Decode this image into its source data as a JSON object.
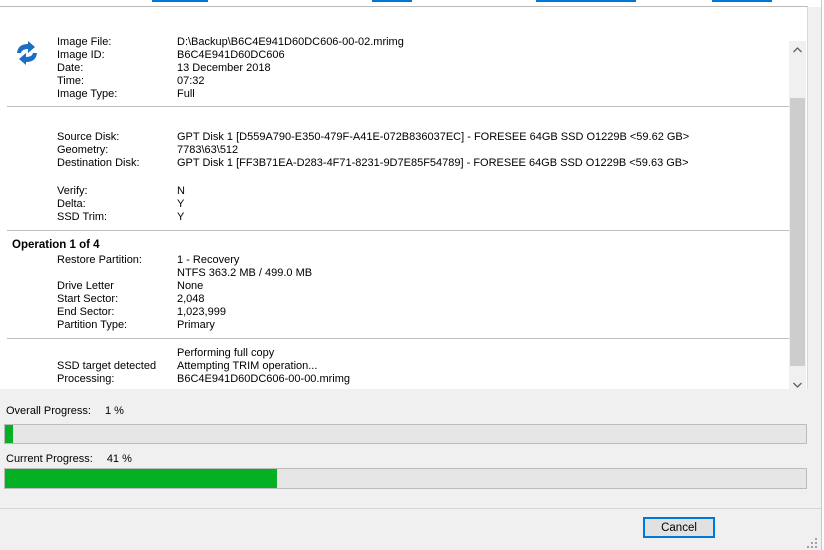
{
  "colors": {
    "progress_fill": "#06b025",
    "accent": "#0078d7"
  },
  "log": {
    "logo": "macrium-reflect-logo-icon",
    "image_info": [
      {
        "label": "Image File:",
        "value": "D:\\Backup\\B6C4E941D60DC606-00-02.mrimg"
      },
      {
        "label": "Image ID:",
        "value": "B6C4E941D60DC606"
      },
      {
        "label": "Date:",
        "value": "13 December 2018"
      },
      {
        "label": "Time:",
        "value": "07:32"
      },
      {
        "label": "Image Type:",
        "value": "Full"
      }
    ],
    "disk_info": [
      {
        "label": "Source Disk:",
        "value": "GPT Disk 1 [D559A790-E350-479F-A41E-072B836037EC] - FORESEE 64GB SSD O1229B  <59.62 GB>"
      },
      {
        "label": "Geometry:",
        "value": "7783\\63\\512"
      },
      {
        "label": "Destination Disk:",
        "value": "GPT Disk 1 [FF3B71EA-D283-4F71-8231-9D7E85F54789] - FORESEE 64GB SSD O1229B  <59.63 GB>"
      }
    ],
    "options": [
      {
        "label": "Verify:",
        "value": "N"
      },
      {
        "label": "Delta:",
        "value": "Y"
      },
      {
        "label": "SSD Trim:",
        "value": "Y"
      }
    ],
    "operation_heading": "Operation  1 of 4",
    "operation": [
      {
        "label": "Restore Partition:",
        "value": "1 - Recovery"
      },
      {
        "label": "",
        "value": "NTFS 363.2 MB / 499.0 MB"
      },
      {
        "label": "Drive Letter",
        "value": "None"
      },
      {
        "label": "Start Sector:",
        "value": "2,048"
      },
      {
        "label": "End Sector:",
        "value": "1,023,999"
      },
      {
        "label": "Partition Type:",
        "value": "Primary"
      }
    ],
    "status": [
      {
        "label": "",
        "value": "Performing full copy"
      },
      {
        "label": "SSD target detected",
        "value": "Attempting TRIM operation..."
      },
      {
        "label": "Processing:",
        "value": "B6C4E941D60DC606-00-00.mrimg"
      }
    ]
  },
  "scrollbar": {
    "up_icon": "chevron-up-icon",
    "down_icon": "chevron-down-icon"
  },
  "overall": {
    "label": "Overall Progress:",
    "value_text": "1 %",
    "fraction": 0.01
  },
  "current": {
    "label": "Current Progress:",
    "value_text": "41 %",
    "fraction": 0.34
  },
  "buttons": {
    "cancel": "Cancel"
  }
}
